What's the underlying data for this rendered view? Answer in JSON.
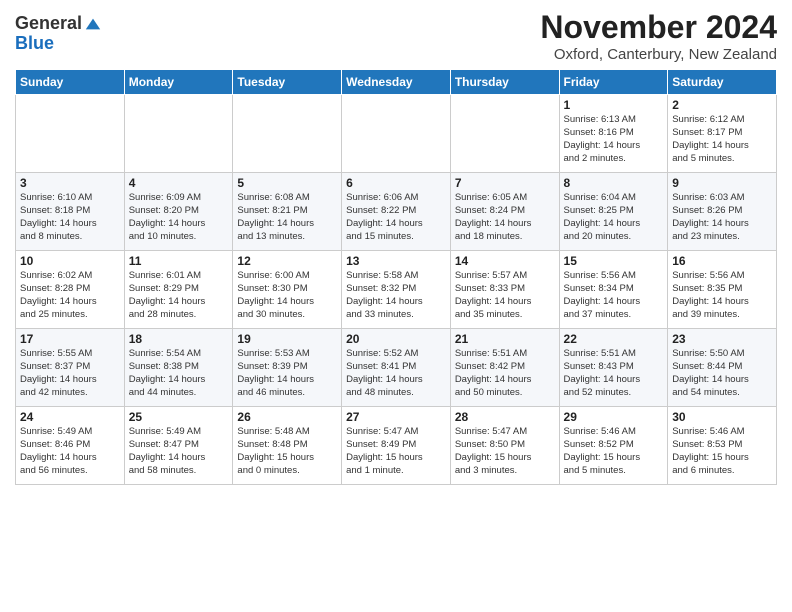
{
  "header": {
    "logo_line1": "General",
    "logo_line2": "Blue",
    "month_title": "November 2024",
    "location": "Oxford, Canterbury, New Zealand"
  },
  "weekdays": [
    "Sunday",
    "Monday",
    "Tuesday",
    "Wednesday",
    "Thursday",
    "Friday",
    "Saturday"
  ],
  "weeks": [
    [
      {
        "day": "",
        "info": ""
      },
      {
        "day": "",
        "info": ""
      },
      {
        "day": "",
        "info": ""
      },
      {
        "day": "",
        "info": ""
      },
      {
        "day": "",
        "info": ""
      },
      {
        "day": "1",
        "info": "Sunrise: 6:13 AM\nSunset: 8:16 PM\nDaylight: 14 hours\nand 2 minutes."
      },
      {
        "day": "2",
        "info": "Sunrise: 6:12 AM\nSunset: 8:17 PM\nDaylight: 14 hours\nand 5 minutes."
      }
    ],
    [
      {
        "day": "3",
        "info": "Sunrise: 6:10 AM\nSunset: 8:18 PM\nDaylight: 14 hours\nand 8 minutes."
      },
      {
        "day": "4",
        "info": "Sunrise: 6:09 AM\nSunset: 8:20 PM\nDaylight: 14 hours\nand 10 minutes."
      },
      {
        "day": "5",
        "info": "Sunrise: 6:08 AM\nSunset: 8:21 PM\nDaylight: 14 hours\nand 13 minutes."
      },
      {
        "day": "6",
        "info": "Sunrise: 6:06 AM\nSunset: 8:22 PM\nDaylight: 14 hours\nand 15 minutes."
      },
      {
        "day": "7",
        "info": "Sunrise: 6:05 AM\nSunset: 8:24 PM\nDaylight: 14 hours\nand 18 minutes."
      },
      {
        "day": "8",
        "info": "Sunrise: 6:04 AM\nSunset: 8:25 PM\nDaylight: 14 hours\nand 20 minutes."
      },
      {
        "day": "9",
        "info": "Sunrise: 6:03 AM\nSunset: 8:26 PM\nDaylight: 14 hours\nand 23 minutes."
      }
    ],
    [
      {
        "day": "10",
        "info": "Sunrise: 6:02 AM\nSunset: 8:28 PM\nDaylight: 14 hours\nand 25 minutes."
      },
      {
        "day": "11",
        "info": "Sunrise: 6:01 AM\nSunset: 8:29 PM\nDaylight: 14 hours\nand 28 minutes."
      },
      {
        "day": "12",
        "info": "Sunrise: 6:00 AM\nSunset: 8:30 PM\nDaylight: 14 hours\nand 30 minutes."
      },
      {
        "day": "13",
        "info": "Sunrise: 5:58 AM\nSunset: 8:32 PM\nDaylight: 14 hours\nand 33 minutes."
      },
      {
        "day": "14",
        "info": "Sunrise: 5:57 AM\nSunset: 8:33 PM\nDaylight: 14 hours\nand 35 minutes."
      },
      {
        "day": "15",
        "info": "Sunrise: 5:56 AM\nSunset: 8:34 PM\nDaylight: 14 hours\nand 37 minutes."
      },
      {
        "day": "16",
        "info": "Sunrise: 5:56 AM\nSunset: 8:35 PM\nDaylight: 14 hours\nand 39 minutes."
      }
    ],
    [
      {
        "day": "17",
        "info": "Sunrise: 5:55 AM\nSunset: 8:37 PM\nDaylight: 14 hours\nand 42 minutes."
      },
      {
        "day": "18",
        "info": "Sunrise: 5:54 AM\nSunset: 8:38 PM\nDaylight: 14 hours\nand 44 minutes."
      },
      {
        "day": "19",
        "info": "Sunrise: 5:53 AM\nSunset: 8:39 PM\nDaylight: 14 hours\nand 46 minutes."
      },
      {
        "day": "20",
        "info": "Sunrise: 5:52 AM\nSunset: 8:41 PM\nDaylight: 14 hours\nand 48 minutes."
      },
      {
        "day": "21",
        "info": "Sunrise: 5:51 AM\nSunset: 8:42 PM\nDaylight: 14 hours\nand 50 minutes."
      },
      {
        "day": "22",
        "info": "Sunrise: 5:51 AM\nSunset: 8:43 PM\nDaylight: 14 hours\nand 52 minutes."
      },
      {
        "day": "23",
        "info": "Sunrise: 5:50 AM\nSunset: 8:44 PM\nDaylight: 14 hours\nand 54 minutes."
      }
    ],
    [
      {
        "day": "24",
        "info": "Sunrise: 5:49 AM\nSunset: 8:46 PM\nDaylight: 14 hours\nand 56 minutes."
      },
      {
        "day": "25",
        "info": "Sunrise: 5:49 AM\nSunset: 8:47 PM\nDaylight: 14 hours\nand 58 minutes."
      },
      {
        "day": "26",
        "info": "Sunrise: 5:48 AM\nSunset: 8:48 PM\nDaylight: 15 hours\nand 0 minutes."
      },
      {
        "day": "27",
        "info": "Sunrise: 5:47 AM\nSunset: 8:49 PM\nDaylight: 15 hours\nand 1 minute."
      },
      {
        "day": "28",
        "info": "Sunrise: 5:47 AM\nSunset: 8:50 PM\nDaylight: 15 hours\nand 3 minutes."
      },
      {
        "day": "29",
        "info": "Sunrise: 5:46 AM\nSunset: 8:52 PM\nDaylight: 15 hours\nand 5 minutes."
      },
      {
        "day": "30",
        "info": "Sunrise: 5:46 AM\nSunset: 8:53 PM\nDaylight: 15 hours\nand 6 minutes."
      }
    ]
  ]
}
